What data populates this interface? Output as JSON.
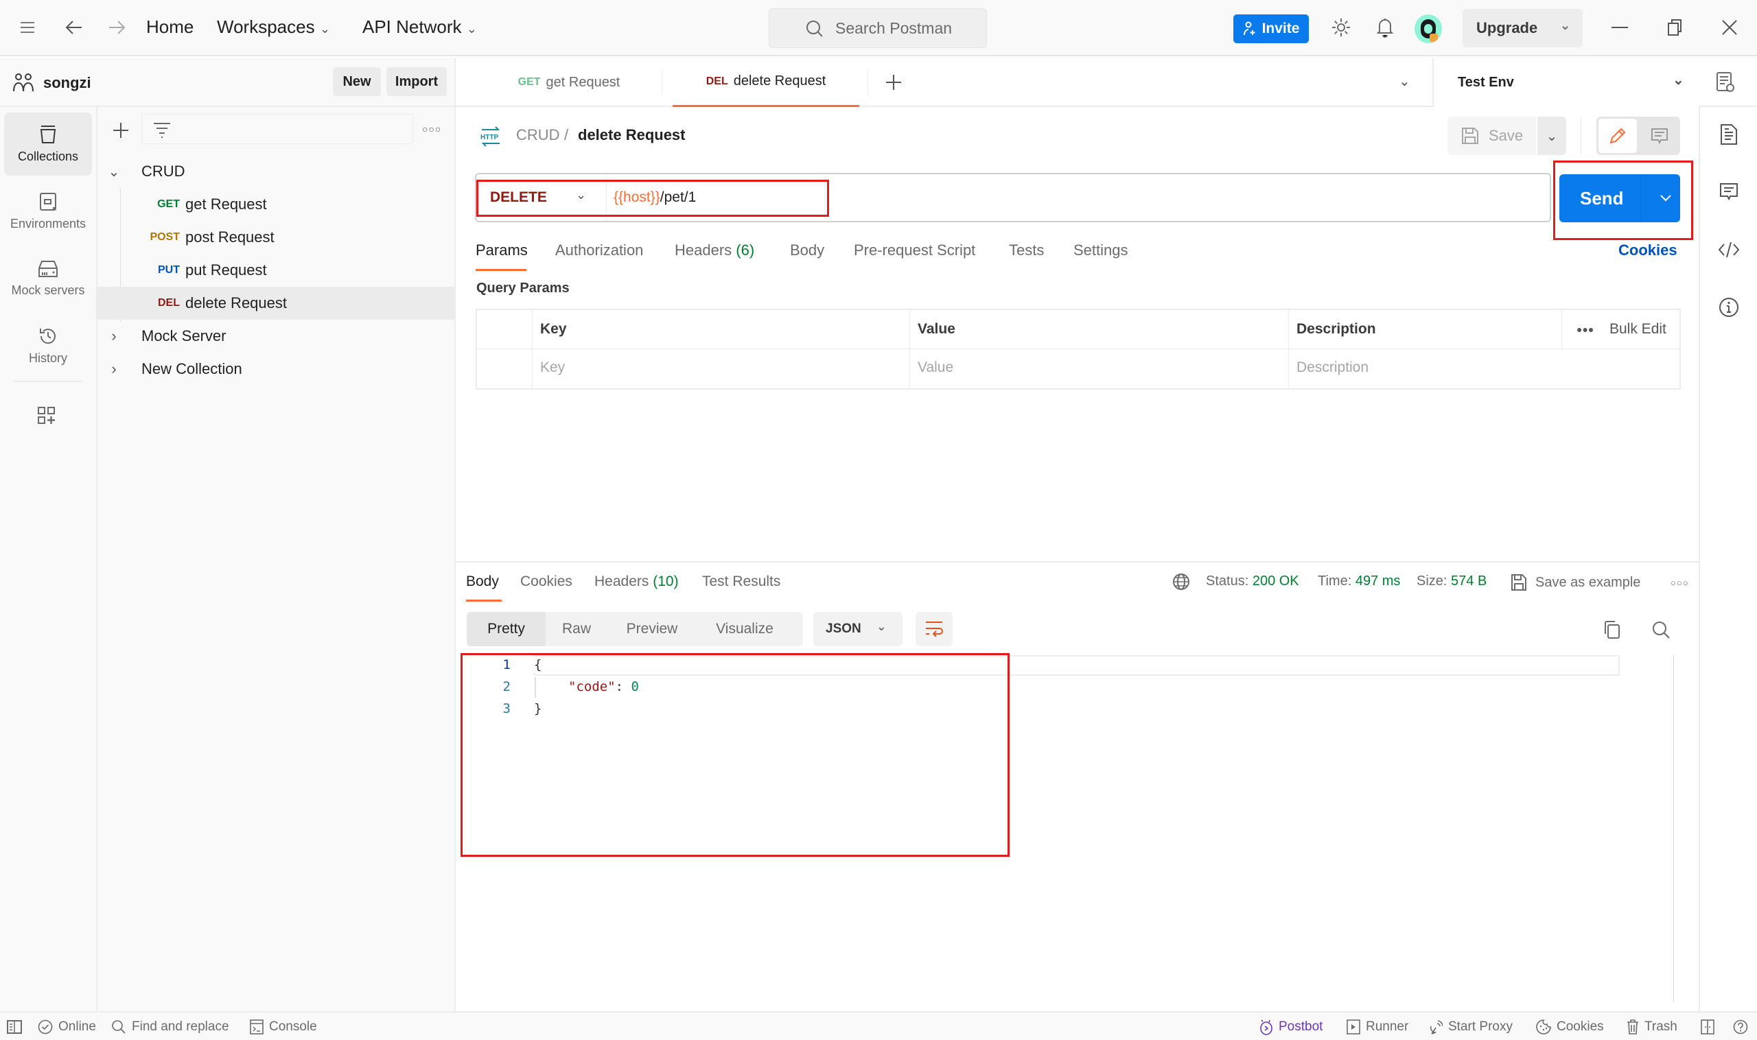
{
  "topbar": {
    "home": "Home",
    "workspaces": "Workspaces",
    "api_network": "API Network",
    "search_placeholder": "Search Postman",
    "invite": "Invite",
    "upgrade": "Upgrade"
  },
  "workspace": {
    "name": "songzi",
    "new_label": "New",
    "import_label": "Import"
  },
  "rail": [
    {
      "label": "Collections",
      "icon": "collections-icon",
      "active": true
    },
    {
      "label": "Environments",
      "icon": "environments-icon"
    },
    {
      "label": "Mock servers",
      "icon": "mock-servers-icon"
    },
    {
      "label": "History",
      "icon": "history-icon"
    }
  ],
  "tree": {
    "collections": [
      {
        "name": "CRUD",
        "expanded": true
      },
      {
        "name": "Mock Server",
        "expanded": false
      },
      {
        "name": "New Collection",
        "expanded": false
      }
    ],
    "requests": [
      {
        "method": "GET",
        "name": "get Request",
        "color": "#007f31"
      },
      {
        "method": "POST",
        "name": "post Request",
        "color": "#ad7a03"
      },
      {
        "method": "PUT",
        "name": "put Request",
        "color": "#0053b8"
      },
      {
        "method": "DEL",
        "name": "delete Request",
        "color": "#8e1a10",
        "selected": true
      }
    ]
  },
  "tabs": [
    {
      "method": "GET",
      "name": "get Request",
      "color": "#6bbf8a"
    },
    {
      "method": "DEL",
      "name": "delete Request",
      "color": "#8e1a10",
      "active": true
    }
  ],
  "environment": "Test Env",
  "request": {
    "breadcrumb_parent": "CRUD",
    "breadcrumb_sep": "/",
    "breadcrumb_current": "delete Request",
    "save_label": "Save",
    "method": "DELETE",
    "url_var": "{{host}}",
    "url_path": "/pet/1",
    "send_label": "Send",
    "cookies_link": "Cookies",
    "tabs": [
      {
        "label": "Params",
        "active": true
      },
      {
        "label": "Authorization"
      },
      {
        "label": "Headers",
        "count": "(6)"
      },
      {
        "label": "Body"
      },
      {
        "label": "Pre-request Script"
      },
      {
        "label": "Tests"
      },
      {
        "label": "Settings"
      }
    ],
    "query_params_title": "Query Params",
    "table_headers": [
      "Key",
      "Value",
      "Description"
    ],
    "bulk_edit": "Bulk Edit",
    "placeholders": [
      "Key",
      "Value",
      "Description"
    ]
  },
  "response": {
    "tabs": [
      {
        "label": "Body",
        "active": true
      },
      {
        "label": "Cookies"
      },
      {
        "label": "Headers",
        "count": "(10)"
      },
      {
        "label": "Test Results"
      }
    ],
    "status_label": "Status:",
    "status_value": "200 OK",
    "time_label": "Time:",
    "time_value": "497 ms",
    "size_label": "Size:",
    "size_value": "574 B",
    "save_example": "Save as example",
    "formats": [
      "Pretty",
      "Raw",
      "Preview",
      "Visualize"
    ],
    "language": "JSON",
    "lines": [
      {
        "n": "1",
        "text": "{"
      },
      {
        "n": "2",
        "key": "\"code\"",
        "sep": ": ",
        "value": "0"
      },
      {
        "n": "3",
        "text": "}"
      }
    ]
  },
  "statusbar": {
    "online": "Online",
    "find_replace": "Find and replace",
    "console": "Console",
    "postbot": "Postbot",
    "runner": "Runner",
    "start_proxy": "Start Proxy",
    "cookies": "Cookies",
    "trash": "Trash"
  },
  "colors": {
    "accent": "#ff6c37",
    "primary": "#097bed",
    "success": "#007f31",
    "highlight_box": "#e41b1b",
    "postbot": "#6b37b5"
  }
}
